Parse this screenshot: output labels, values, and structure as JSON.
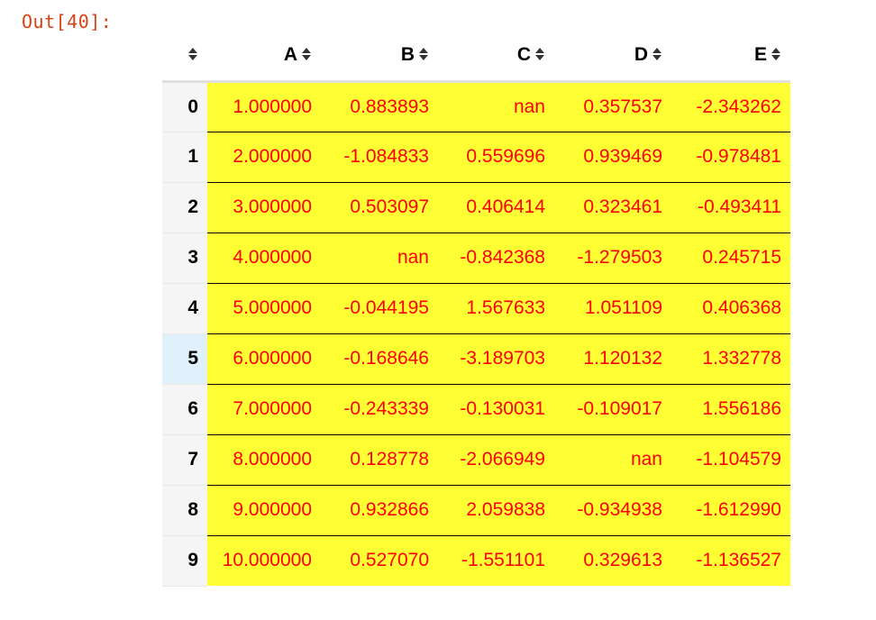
{
  "output": {
    "prompt": "Out[40]:"
  },
  "table": {
    "columns": [
      "A",
      "B",
      "C",
      "D",
      "E"
    ],
    "index": [
      "0",
      "1",
      "2",
      "3",
      "4",
      "5",
      "6",
      "7",
      "8",
      "9"
    ],
    "rows": [
      [
        "1.000000",
        "0.883893",
        "nan",
        "0.357537",
        "-2.343262"
      ],
      [
        "2.000000",
        "-1.084833",
        "0.559696",
        "0.939469",
        "-0.978481"
      ],
      [
        "3.000000",
        "0.503097",
        "0.406414",
        "0.323461",
        "-0.493411"
      ],
      [
        "4.000000",
        "nan",
        "-0.842368",
        "-1.279503",
        "0.245715"
      ],
      [
        "5.000000",
        "-0.044195",
        "1.567633",
        "1.051109",
        "0.406368"
      ],
      [
        "6.000000",
        "-0.168646",
        "-3.189703",
        "1.120132",
        "1.332778"
      ],
      [
        "7.000000",
        "-0.243339",
        "-0.130031",
        "-0.109017",
        "1.556186"
      ],
      [
        "8.000000",
        "0.128778",
        "-2.066949",
        "nan",
        "-1.104579"
      ],
      [
        "9.000000",
        "0.932866",
        "2.059838",
        "-0.934938",
        "-1.612990"
      ],
      [
        "10.000000",
        "0.527070",
        "-1.551101",
        "0.329613",
        "-1.136527"
      ]
    ],
    "hovered_row": 5,
    "colors": {
      "cell_background": "#ffff33",
      "cell_text": "#ff0000",
      "prompt": "#d84315",
      "index_background": "#f5f5f5",
      "index_hover_background": "#e1f1fc"
    },
    "icons": {
      "sort": "sort-updown-icon"
    }
  }
}
